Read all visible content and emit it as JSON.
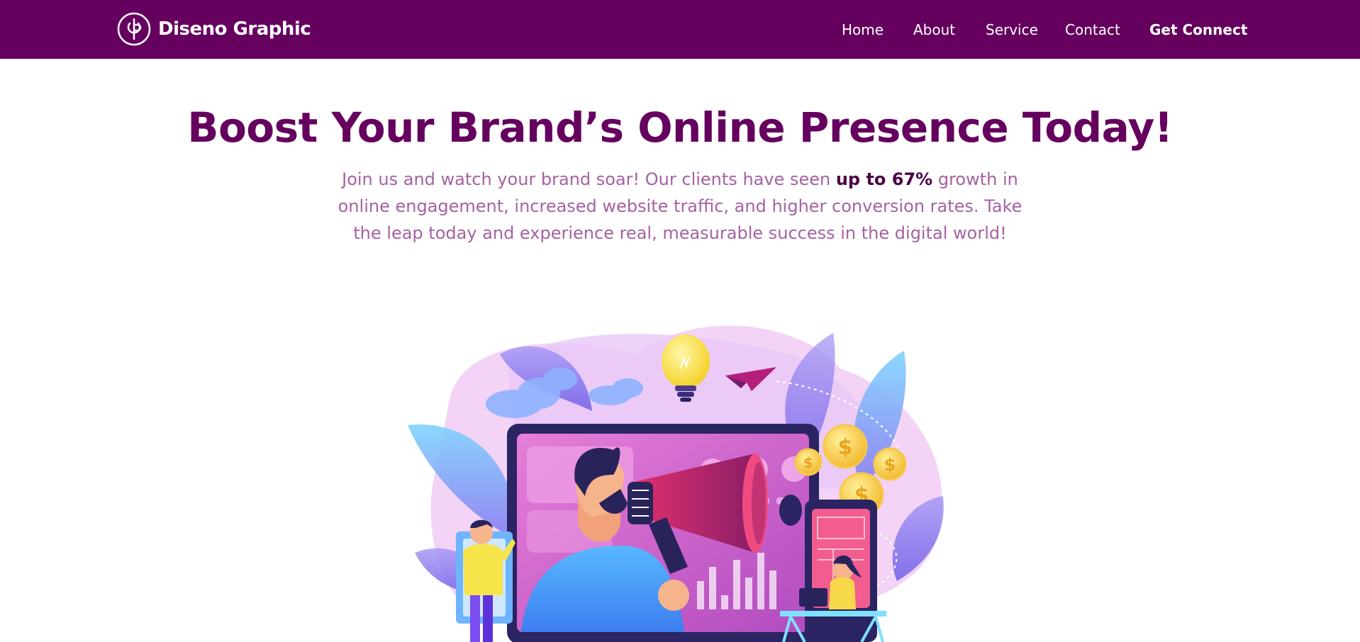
{
  "brand": {
    "name": "Diseno Graphic",
    "logo_icon": "dg-monogram-icon",
    "color_primary": "#65005e",
    "color_text_muted": "#a562a1"
  },
  "nav": {
    "items": [
      {
        "label": "Home"
      },
      {
        "label": "About"
      },
      {
        "label": "Service"
      },
      {
        "label": "Contact"
      },
      {
        "label": "Get Connect"
      }
    ]
  },
  "hero": {
    "title": "Boost Your Brand’s Online Presence Today!",
    "subtitle_before": "Join us and watch your brand soar! Our clients have seen ",
    "subtitle_highlight": "up to 67%",
    "subtitle_after": " growth in online engagement, increased website traffic, and higher conversion rates. Take the leap today and experience real, measurable success in the digital world!"
  },
  "illustration": {
    "icon": "digital-marketing-megaphone-illustration"
  }
}
